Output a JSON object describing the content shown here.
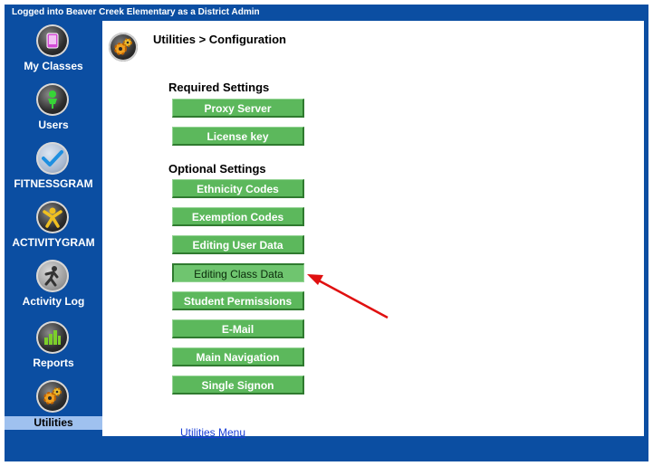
{
  "header": {
    "login_status": "Logged into Beaver Creek Elementary as a District Admin"
  },
  "sidebar": {
    "items": [
      {
        "label": "My Classes",
        "icon": "tablet-icon",
        "active": false
      },
      {
        "label": "Users",
        "icon": "person-icon",
        "active": false
      },
      {
        "label": "FITNESSGRAM",
        "icon": "checkmark-icon",
        "active": false
      },
      {
        "label": "ACTIVITYGRAM",
        "icon": "activity-figure-icon",
        "active": false
      },
      {
        "label": "Activity Log",
        "icon": "running-figure-icon",
        "active": false
      },
      {
        "label": "Reports",
        "icon": "bar-chart-icon",
        "active": false
      },
      {
        "label": "Utilities",
        "icon": "gears-icon",
        "active": true
      }
    ]
  },
  "main": {
    "breadcrumb": "Utilities > Configuration",
    "page_icon": "gears-icon",
    "required_section": {
      "title": "Required Settings",
      "buttons": [
        "Proxy Server",
        "License key"
      ]
    },
    "optional_section": {
      "title": "Optional Settings",
      "buttons": [
        "Ethnicity Codes",
        "Exemption Codes",
        "Editing User Data",
        "Editing Class Data",
        "Student Permissions",
        "E-Mail",
        "Main Navigation",
        "Single Signon"
      ]
    },
    "footer_link": "Utilities Menu"
  },
  "colors": {
    "frame": "#0b4ea2",
    "button": "#5cb85c",
    "active_nav": "#9fc1ef",
    "annotation_arrow": "#e01010"
  }
}
